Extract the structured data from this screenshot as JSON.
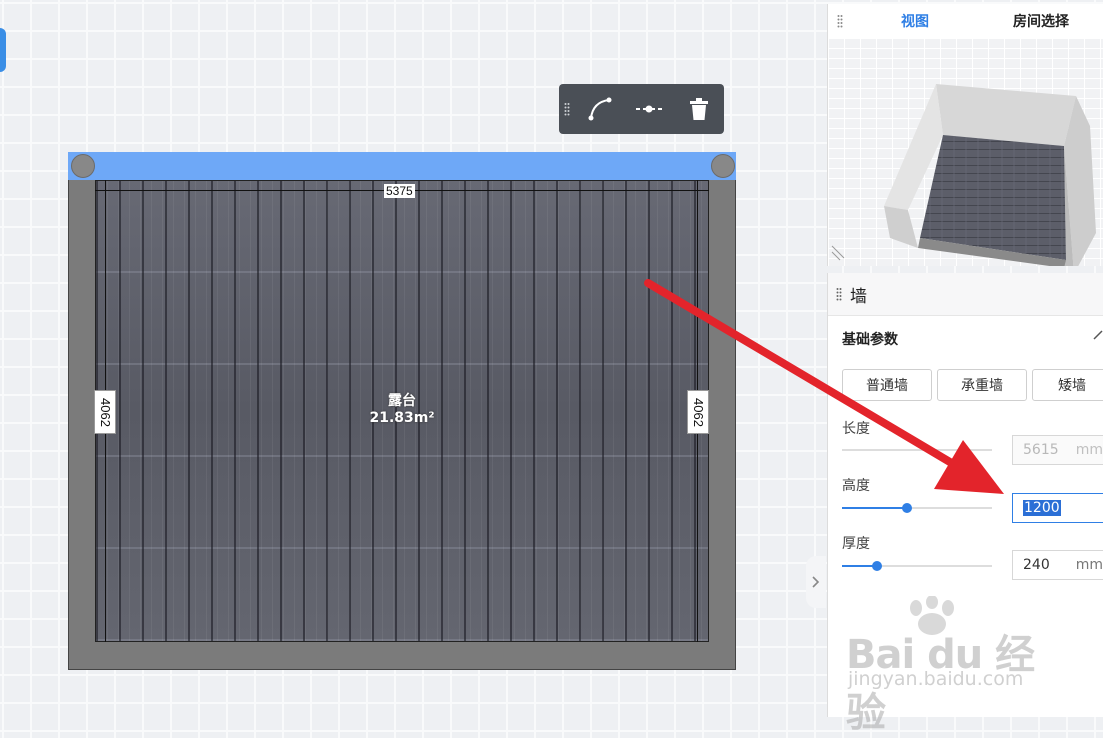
{
  "canvas": {
    "room_name": "露台",
    "room_area": "21.83m²",
    "dim_top": "5375",
    "dim_left": "4062",
    "dim_right": "4062"
  },
  "toolbar": {
    "icons": [
      "arc-wall-icon",
      "split-wall-icon",
      "trash-icon"
    ]
  },
  "view_panel": {
    "tabs": [
      {
        "label": "视图",
        "active": true
      },
      {
        "label": "房间选择",
        "active": false
      }
    ]
  },
  "wall_panel": {
    "title": "墙",
    "section": "基础参数",
    "wall_types": [
      "普通墙",
      "承重墙",
      "矮墙"
    ],
    "params": {
      "length": {
        "label": "长度",
        "value": "5615",
        "unit": "mm"
      },
      "height": {
        "label": "高度",
        "value": "1200",
        "unit": "mm",
        "level": 0.43
      },
      "thickness": {
        "label": "厚度",
        "value": "240",
        "unit": "mm",
        "level": 0.23
      }
    }
  },
  "watermark": {
    "main": "Bai du 经验",
    "sub": "jingyan.baidu.com"
  },
  "colors": {
    "accent": "#2f7fe5",
    "selected_wall": "#6ea8f7",
    "annotation_arrow": "#e3242b"
  }
}
